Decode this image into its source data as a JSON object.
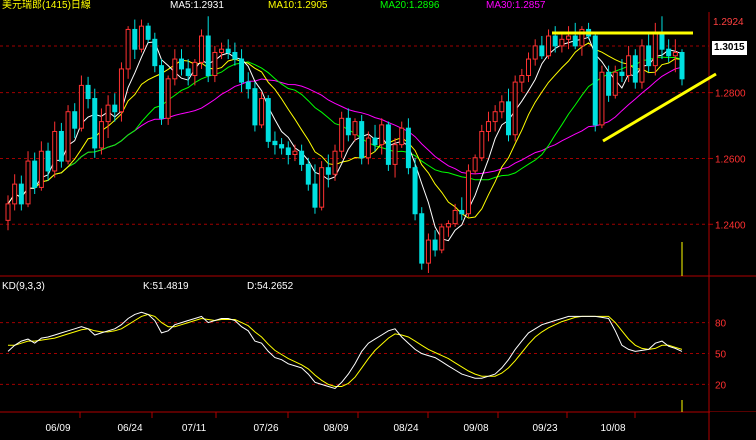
{
  "chart_data": {
    "type": "candlestick",
    "symbol": "美元瑞郎(1415)日線",
    "ma_labels": [
      {
        "text": "MA5:1.2931",
        "color": "#ffffff"
      },
      {
        "text": "MA10:1.2905",
        "color": "#ffff00"
      },
      {
        "text": "MA20:1.2896",
        "color": "#00ff00"
      },
      {
        "text": "MA30:1.2857",
        "color": "#ff00ff"
      }
    ],
    "price_axis": {
      "ylim": [
        1.2255,
        1.3045
      ],
      "ticks": [
        "1.2800",
        "1.2600",
        "1.2400"
      ],
      "max_label": "1.2924",
      "current_label": "1.3015"
    },
    "kd_label": "KD(9,3,3)",
    "k_label": "K:51.4819",
    "d_label": "D:54.2652",
    "kd_axis": {
      "ylim": [
        0,
        100
      ],
      "ticks": [
        "80",
        "50",
        "20"
      ]
    },
    "date_labels": [
      "06/09",
      "06/24",
      "07/11",
      "07/26",
      "08/09",
      "08/24",
      "09/08",
      "09/23",
      "10/08"
    ],
    "candles_ohlc": [
      [
        1.2412,
        1.2488,
        1.2382,
        1.2462
      ],
      [
        1.2462,
        1.2552,
        1.2442,
        1.2522
      ],
      [
        1.2522,
        1.2548,
        1.2442,
        1.2462
      ],
      [
        1.2462,
        1.2622,
        1.2452,
        1.2592
      ],
      [
        1.2592,
        1.2618,
        1.2492,
        1.2512
      ],
      [
        1.2512,
        1.2652,
        1.2502,
        1.2622
      ],
      [
        1.2622,
        1.2648,
        1.2532,
        1.2562
      ],
      [
        1.2562,
        1.2712,
        1.2542,
        1.2682
      ],
      [
        1.2682,
        1.2708,
        1.2572,
        1.2592
      ],
      [
        1.2592,
        1.2762,
        1.2582,
        1.2742
      ],
      [
        1.2742,
        1.2768,
        1.2662,
        1.2692
      ],
      [
        1.2692,
        1.2852,
        1.2682,
        1.2822
      ],
      [
        1.2822,
        1.2848,
        1.2752,
        1.2782
      ],
      [
        1.2782,
        1.2812,
        1.2602,
        1.2632
      ],
      [
        1.2632,
        1.2752,
        1.2612,
        1.2712
      ],
      [
        1.2712,
        1.2792,
        1.2662,
        1.2762
      ],
      [
        1.2762,
        1.2798,
        1.2712,
        1.2742
      ],
      [
        1.2742,
        1.2892,
        1.2712,
        1.2872
      ],
      [
        1.2872,
        1.3002,
        1.2842,
        1.2992
      ],
      [
        1.2992,
        1.3022,
        1.2902,
        1.2932
      ],
      [
        1.2932,
        1.3022,
        1.2922,
        1.3002
      ],
      [
        1.3002,
        1.3012,
        1.2952,
        1.2962
      ],
      [
        1.2962,
        1.2982,
        1.2862,
        1.2882
      ],
      [
        1.2882,
        1.2902,
        1.2702,
        1.2722
      ],
      [
        1.2722,
        1.2852,
        1.2702,
        1.2842
      ],
      [
        1.2842,
        1.2932,
        1.2822,
        1.2902
      ],
      [
        1.2902,
        1.2932,
        1.2852,
        1.2872
      ],
      [
        1.2872,
        1.2902,
        1.2822,
        1.2852
      ],
      [
        1.2852,
        1.2902,
        1.2822,
        1.2892
      ],
      [
        1.2892,
        1.2992,
        1.2872,
        1.2972
      ],
      [
        1.2972,
        1.3032,
        1.2832,
        1.2852
      ],
      [
        1.2852,
        1.2942,
        1.2832,
        1.2922
      ],
      [
        1.2922,
        1.2952,
        1.2902,
        1.2932
      ],
      [
        1.2932,
        1.2962,
        1.2902,
        1.2922
      ],
      [
        1.2922,
        1.2952,
        1.2882,
        1.2902
      ],
      [
        1.2902,
        1.2932,
        1.2802,
        1.2832
      ],
      [
        1.2832,
        1.2862,
        1.2782,
        1.2812
      ],
      [
        1.2812,
        1.2832,
        1.2682,
        1.2702
      ],
      [
        1.2702,
        1.2802,
        1.2692,
        1.2782
      ],
      [
        1.2782,
        1.2792,
        1.2632,
        1.2652
      ],
      [
        1.2652,
        1.2682,
        1.2612,
        1.2642
      ],
      [
        1.2642,
        1.2662,
        1.2612,
        1.2632
      ],
      [
        1.2632,
        1.2652,
        1.2582,
        1.2612
      ],
      [
        1.2612,
        1.2642,
        1.2592,
        1.2622
      ],
      [
        1.2622,
        1.2642,
        1.2562,
        1.2582
      ],
      [
        1.2582,
        1.2602,
        1.2502,
        1.2522
      ],
      [
        1.2522,
        1.2582,
        1.2432,
        1.2452
      ],
      [
        1.2452,
        1.2592,
        1.2442,
        1.2572
      ],
      [
        1.2572,
        1.2612,
        1.2512,
        1.2552
      ],
      [
        1.2552,
        1.2642,
        1.2532,
        1.2622
      ],
      [
        1.2622,
        1.2742,
        1.2602,
        1.2722
      ],
      [
        1.2722,
        1.2752,
        1.2652,
        1.2672
      ],
      [
        1.2672,
        1.2722,
        1.2652,
        1.2712
      ],
      [
        1.2712,
        1.2732,
        1.2582,
        1.2602
      ],
      [
        1.2602,
        1.2682,
        1.2582,
        1.2662
      ],
      [
        1.2662,
        1.2702,
        1.2622,
        1.2642
      ],
      [
        1.2642,
        1.2722,
        1.2612,
        1.2702
      ],
      [
        1.2702,
        1.2712,
        1.2562,
        1.2582
      ],
      [
        1.2582,
        1.2662,
        1.2542,
        1.2642
      ],
      [
        1.2642,
        1.2712,
        1.2632,
        1.2692
      ],
      [
        1.2692,
        1.2722,
        1.2552,
        1.2572
      ],
      [
        1.2572,
        1.2602,
        1.2412,
        1.2432
      ],
      [
        1.2432,
        1.2452,
        1.2262,
        1.2282
      ],
      [
        1.2282,
        1.2372,
        1.2252,
        1.2352
      ],
      [
        1.2352,
        1.2382,
        1.2302,
        1.2322
      ],
      [
        1.2322,
        1.2402,
        1.2312,
        1.2392
      ],
      [
        1.2392,
        1.2412,
        1.2362,
        1.2402
      ],
      [
        1.2402,
        1.2462,
        1.2392,
        1.2442
      ],
      [
        1.2442,
        1.2482,
        1.2412,
        1.2432
      ],
      [
        1.2432,
        1.2582,
        1.2422,
        1.2562
      ],
      [
        1.2562,
        1.2612,
        1.2552,
        1.2602
      ],
      [
        1.2602,
        1.2702,
        1.2592,
        1.2682
      ],
      [
        1.2682,
        1.2742,
        1.2652,
        1.2712
      ],
      [
        1.2712,
        1.2762,
        1.2682,
        1.2742
      ],
      [
        1.2742,
        1.2792,
        1.2722,
        1.2772
      ],
      [
        1.2772,
        1.2812,
        1.2652,
        1.2672
      ],
      [
        1.2672,
        1.2852,
        1.2652,
        1.2832
      ],
      [
        1.2832,
        1.2872,
        1.2802,
        1.2852
      ],
      [
        1.2852,
        1.2922,
        1.2832,
        1.2902
      ],
      [
        1.2902,
        1.2962,
        1.2882,
        1.2942
      ],
      [
        1.2942,
        1.2972,
        1.2902,
        1.2912
      ],
      [
        1.2912,
        1.2992,
        1.2902,
        1.2972
      ],
      [
        1.2972,
        1.3002,
        1.2922,
        1.2942
      ],
      [
        1.2942,
        1.2982,
        1.2922,
        1.2962
      ],
      [
        1.2962,
        1.3002,
        1.2932,
        1.2972
      ],
      [
        1.2972,
        1.3012,
        1.2932,
        1.2942
      ],
      [
        1.2942,
        1.3002,
        1.2912,
        1.2992
      ],
      [
        1.2992,
        1.3012,
        1.2962,
        1.2972
      ],
      [
        1.2972,
        1.2982,
        1.2682,
        1.2702
      ],
      [
        1.2702,
        1.2882,
        1.2692,
        1.2862
      ],
      [
        1.2862,
        1.2882,
        1.2772,
        1.2792
      ],
      [
        1.2792,
        1.2882,
        1.2782,
        1.2862
      ],
      [
        1.2862,
        1.2902,
        1.2832,
        1.2852
      ],
      [
        1.2852,
        1.2942,
        1.2832,
        1.2912
      ],
      [
        1.2912,
        1.2932,
        1.2812,
        1.2832
      ],
      [
        1.2832,
        1.2962,
        1.2812,
        1.2942
      ],
      [
        1.2942,
        1.2982,
        1.2862,
        1.2882
      ],
      [
        1.2882,
        1.3012,
        1.2852,
        1.2982
      ],
      [
        1.2982,
        1.3032,
        1.2902,
        1.2932
      ],
      [
        1.2932,
        1.2962,
        1.2892,
        1.2912
      ],
      [
        1.2912,
        1.2962,
        1.2862,
        1.2922
      ],
      [
        1.2922,
        1.2932,
        1.2822,
        1.2842
      ]
    ],
    "k_values": [
      52,
      58,
      62,
      64,
      60,
      65,
      66,
      68,
      70,
      72,
      74,
      76,
      74,
      68,
      70,
      72,
      74,
      78,
      84,
      88,
      90,
      88,
      82,
      70,
      72,
      78,
      80,
      82,
      84,
      86,
      80,
      82,
      84,
      84,
      82,
      76,
      72,
      62,
      60,
      52,
      46,
      44,
      40,
      38,
      36,
      30,
      22,
      20,
      18,
      16,
      22,
      30,
      40,
      52,
      60,
      64,
      68,
      72,
      74,
      66,
      60,
      54,
      50,
      48,
      46,
      42,
      38,
      34,
      30,
      28,
      26,
      26,
      28,
      30,
      36,
      44,
      54,
      62,
      70,
      74,
      78,
      80,
      82,
      84,
      86,
      86,
      86,
      86,
      86,
      85,
      84,
      72,
      58,
      54,
      52,
      53,
      54,
      60,
      62,
      57,
      55,
      52
    ],
    "d_values": [
      58,
      58,
      60,
      62,
      62,
      63,
      64,
      65,
      67,
      69,
      71,
      73,
      74,
      72,
      71,
      71,
      72,
      74,
      78,
      82,
      86,
      88,
      86,
      80,
      76,
      76,
      78,
      80,
      82,
      84,
      83,
      82,
      83,
      83,
      83,
      80,
      77,
      71,
      66,
      59,
      53,
      49,
      45,
      42,
      39,
      35,
      29,
      24,
      20,
      18,
      18,
      21,
      27,
      36,
      45,
      53,
      59,
      65,
      69,
      68,
      66,
      62,
      58,
      54,
      51,
      48,
      45,
      41,
      37,
      33,
      30,
      28,
      28,
      28,
      31,
      36,
      43,
      51,
      59,
      66,
      71,
      75,
      78,
      81,
      83,
      85,
      86,
      86,
      86,
      86,
      86,
      80,
      72,
      64,
      58,
      55,
      54,
      55,
      58,
      58,
      56,
      54
    ]
  }
}
